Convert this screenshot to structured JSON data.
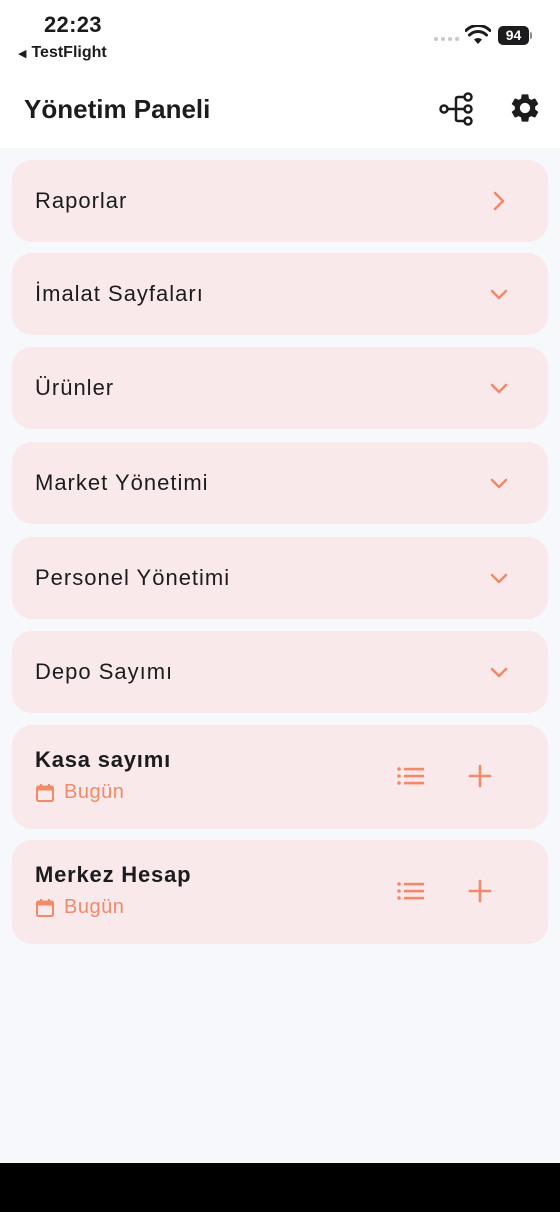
{
  "status": {
    "time": "22:23",
    "back_app": "TestFlight",
    "battery": "94"
  },
  "header": {
    "title": "Yönetim Paneli"
  },
  "menu": [
    {
      "label": "Raporlar",
      "icon": "chevron-right-icon"
    },
    {
      "label": "İmalat Sayfaları",
      "icon": "chevron-down-icon"
    },
    {
      "label": "Ürünler",
      "icon": "chevron-down-icon"
    },
    {
      "label": "Market Yönetimi",
      "icon": "chevron-down-icon"
    },
    {
      "label": "Personel Yönetimi",
      "icon": "chevron-down-icon"
    },
    {
      "label": "Depo Sayımı",
      "icon": "chevron-down-icon"
    }
  ],
  "counts": [
    {
      "title": "Kasa sayımı",
      "date": "Bugün"
    },
    {
      "title": "Merkez Hesap",
      "date": "Bugün"
    }
  ],
  "colors": {
    "accent": "#F08A6A",
    "card_bg": "#F9E9EA",
    "page_bg": "#F7F8FC"
  }
}
